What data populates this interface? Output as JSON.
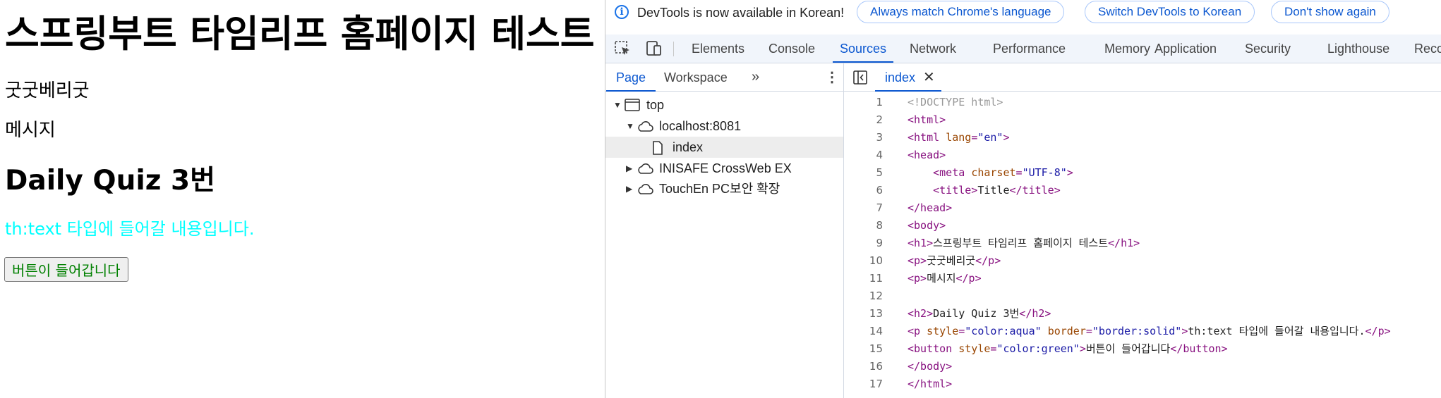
{
  "page": {
    "h1": "스프링부트 타임리프 홈페이지 테스트",
    "p1": "굿굿베리굿",
    "p2": "메시지",
    "h2": "Daily Quiz 3번",
    "p3": "th:text 타입에 들어갈 내용입니다.",
    "button": "버튼이 들어갑니다",
    "p3_color": "#00ffff",
    "button_color": "#008000"
  },
  "infobar": {
    "message": "DevTools is now available in Korean!",
    "btn_match": "Always match Chrome's language",
    "btn_switch": "Switch DevTools to Korean",
    "btn_dismiss": "Don't show again"
  },
  "toolbar": {
    "tabs": [
      "Elements",
      "Console",
      "Sources",
      "Network",
      "Performance",
      "Memory",
      "Application",
      "Security",
      "Lighthouse",
      "Reco"
    ],
    "active": "Sources"
  },
  "navigator": {
    "tabs": [
      "Page",
      "Workspace"
    ],
    "more": "»",
    "tree": {
      "top": "top",
      "host": "localhost:8081",
      "file": "index",
      "ext1": "INISAFE CrossWeb EX",
      "ext2": "TouchEn PC보안 확장"
    }
  },
  "editor": {
    "tab_name": "index",
    "close": "✕",
    "lines": [
      {
        "n": "1",
        "parts": [
          [
            "doctype",
            "<!DOCTYPE html>"
          ]
        ]
      },
      {
        "n": "2",
        "parts": [
          [
            "tag",
            "<html>"
          ]
        ]
      },
      {
        "n": "3",
        "parts": [
          [
            "tag",
            "<html "
          ],
          [
            "attr",
            "lang"
          ],
          [
            "tag",
            "="
          ],
          [
            "val",
            "\"en\""
          ],
          [
            "tag",
            ">"
          ]
        ]
      },
      {
        "n": "4",
        "parts": [
          [
            "tag",
            "<head>"
          ]
        ]
      },
      {
        "n": "5",
        "parts": [
          [
            "txt",
            "    "
          ],
          [
            "tag",
            "<meta "
          ],
          [
            "attr",
            "charset"
          ],
          [
            "tag",
            "="
          ],
          [
            "val",
            "\"UTF-8\""
          ],
          [
            "tag",
            ">"
          ]
        ]
      },
      {
        "n": "6",
        "parts": [
          [
            "txt",
            "    "
          ],
          [
            "tag",
            "<title>"
          ],
          [
            "txt",
            "Title"
          ],
          [
            "tag",
            "</title>"
          ]
        ]
      },
      {
        "n": "7",
        "parts": [
          [
            "tag",
            "</head>"
          ]
        ]
      },
      {
        "n": "8",
        "parts": [
          [
            "tag",
            "<body>"
          ]
        ]
      },
      {
        "n": "9",
        "parts": [
          [
            "tag",
            "<h1>"
          ],
          [
            "txt",
            "스프링부트 타임리프 홈페이지 테스트"
          ],
          [
            "tag",
            "</h1>"
          ]
        ]
      },
      {
        "n": "10",
        "parts": [
          [
            "tag",
            "<p>"
          ],
          [
            "txt",
            "굿굿베리굿"
          ],
          [
            "tag",
            "</p>"
          ]
        ]
      },
      {
        "n": "11",
        "parts": [
          [
            "tag",
            "<p>"
          ],
          [
            "txt",
            "메시지"
          ],
          [
            "tag",
            "</p>"
          ]
        ]
      },
      {
        "n": "12",
        "parts": []
      },
      {
        "n": "13",
        "parts": [
          [
            "tag",
            "<h2>"
          ],
          [
            "txt",
            "Daily Quiz 3번"
          ],
          [
            "tag",
            "</h2>"
          ]
        ]
      },
      {
        "n": "14",
        "parts": [
          [
            "tag",
            "<p "
          ],
          [
            "attr",
            "style"
          ],
          [
            "tag",
            "="
          ],
          [
            "val",
            "\"color:aqua\""
          ],
          [
            "txt",
            " "
          ],
          [
            "attr",
            "border"
          ],
          [
            "tag",
            "="
          ],
          [
            "val",
            "\"border:solid\""
          ],
          [
            "tag",
            ">"
          ],
          [
            "txt",
            "th:text 타입에 들어갈 내용입니다."
          ],
          [
            "tag",
            "</p>"
          ]
        ]
      },
      {
        "n": "15",
        "parts": [
          [
            "tag",
            "<button "
          ],
          [
            "attr",
            "style"
          ],
          [
            "tag",
            "="
          ],
          [
            "val",
            "\"color:green\""
          ],
          [
            "tag",
            ">"
          ],
          [
            "txt",
            "버튼이 들어갑니다"
          ],
          [
            "tag",
            "</button>"
          ]
        ]
      },
      {
        "n": "16",
        "parts": [
          [
            "tag",
            "</body>"
          ]
        ]
      },
      {
        "n": "17",
        "parts": [
          [
            "tag",
            "</html>"
          ]
        ]
      }
    ]
  },
  "colors": {
    "accent": "#0b57d0",
    "tag": "#881280",
    "attr": "#994500",
    "value": "#1a1aa6",
    "toolbar_bg": "#f1f5fb"
  },
  "icons": [
    "info-icon",
    "inspect-element-icon",
    "device-toolbar-icon",
    "more-tabs-icon",
    "kebab-menu-icon",
    "frame-icon",
    "cloud-icon",
    "file-icon",
    "toggle-navigator-icon",
    "close-icon",
    "expand-arrow-icon",
    "collapse-arrow-icon"
  ]
}
